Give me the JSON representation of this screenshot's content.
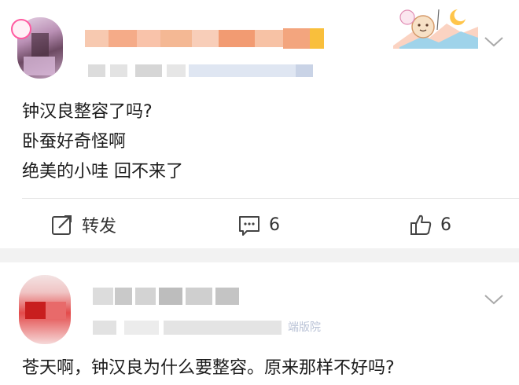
{
  "post1": {
    "body_lines": [
      "钟汉良整容了吗?",
      "卧蚕好奇怪啊",
      "绝美的小哇 回不来了"
    ],
    "actions": {
      "repost_label": "转发",
      "comment_count": "6",
      "like_count": "6"
    }
  },
  "post2": {
    "meta_partial": "端版院",
    "body": "苍天啊，钟汉良为什么要整容。原来那样不好吗?"
  },
  "icons": {
    "repost": "repost-icon",
    "comment": "comment-icon",
    "like": "thumbs-up-icon",
    "more": "chevron-down-icon"
  }
}
